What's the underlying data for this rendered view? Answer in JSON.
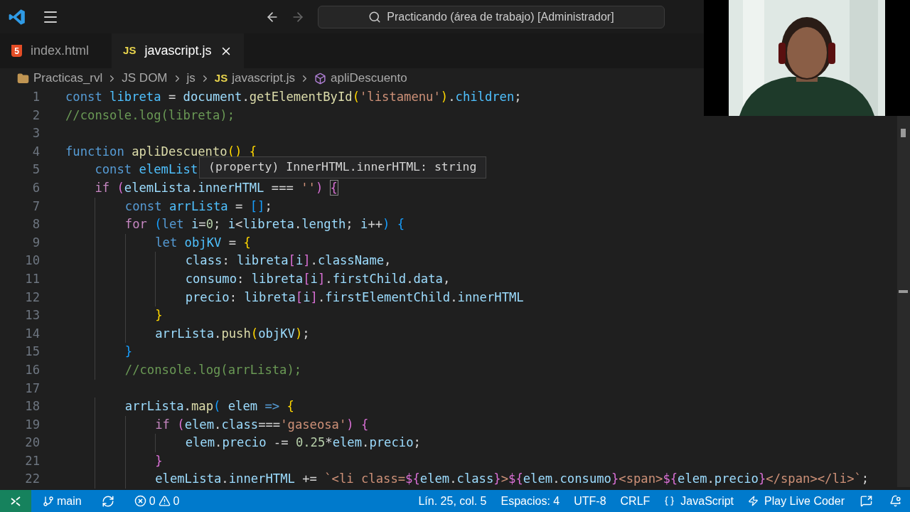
{
  "title_bar": {
    "search": "Practicando (área de trabajo) [Administrador]"
  },
  "tabs": [
    {
      "badge": "5",
      "label": "index.html",
      "kind": "html",
      "selected": false
    },
    {
      "badge": "JS",
      "label": "javascript.js",
      "kind": "js",
      "selected": true
    }
  ],
  "breadcrumbs": [
    {
      "kind": "folder",
      "label": "Practicas_rvl"
    },
    {
      "kind": "plain",
      "label": "JS DOM"
    },
    {
      "kind": "plain",
      "label": "js"
    },
    {
      "kind": "js",
      "badge": "JS",
      "label": "javascript.js"
    },
    {
      "kind": "symbol",
      "label": "apliDescuento"
    }
  ],
  "editor": {
    "lines": [
      {
        "number": "1",
        "tokens": [
          {
            "kind": "kw",
            "text": "const"
          },
          {
            "kind": "cvar",
            "text": " libreta"
          },
          {
            "kind": "pl",
            "text": " = "
          },
          {
            "kind": "var",
            "text": "document"
          },
          {
            "kind": "pl",
            "text": "."
          },
          {
            "kind": "fn",
            "text": "getElementById"
          },
          {
            "kind": "b1",
            "text": "("
          },
          {
            "kind": "str",
            "text": "'listamenu'"
          },
          {
            "kind": "b1",
            "text": ")"
          },
          {
            "kind": "pl",
            "text": "."
          },
          {
            "kind": "cvar",
            "text": "children"
          },
          {
            "kind": "pl",
            "text": ";"
          }
        ]
      },
      {
        "number": "2",
        "tokens": [
          {
            "kind": "comment",
            "text": "//console.log(libreta);"
          }
        ]
      },
      {
        "number": "3"
      },
      {
        "number": "4",
        "tokens": [
          {
            "kind": "kw",
            "text": "function"
          },
          {
            "kind": "fn",
            "text": " apliDescuento"
          },
          {
            "kind": "b1",
            "text": "()"
          },
          {
            "kind": "b1",
            "text": " {"
          }
        ]
      },
      {
        "number": "5",
        "tokens": [
          {
            "kind": "kw",
            "text": "    const"
          },
          {
            "kind": "cvar",
            "text": " elemList"
          }
        ]
      },
      {
        "number": "6",
        "tokens": [
          {
            "kind": "ctl",
            "text": "    if"
          },
          {
            "kind": "b2",
            "text": " ("
          },
          {
            "kind": "var",
            "text": "elemLista"
          },
          {
            "kind": "pl",
            "text": "."
          },
          {
            "kind": "var",
            "text": "innerHTML"
          },
          {
            "kind": "pl",
            "text": " === "
          },
          {
            "kind": "str",
            "text": "''"
          },
          {
            "kind": "b2",
            "text": ") "
          },
          {
            "kind": "match",
            "text": "{"
          }
        ]
      },
      {
        "number": "7",
        "tokens": [
          {
            "kind": "kw",
            "text": "        const"
          },
          {
            "kind": "cvar",
            "text": " arrLista"
          },
          {
            "kind": "pl",
            "text": " = "
          },
          {
            "kind": "b3",
            "text": "[]"
          },
          {
            "kind": "pl",
            "text": ";"
          }
        ]
      },
      {
        "number": "8",
        "tokens": [
          {
            "kind": "ctl",
            "text": "        for"
          },
          {
            "kind": "b3",
            "text": " ("
          },
          {
            "kind": "kw",
            "text": "let"
          },
          {
            "kind": "var",
            "text": " i"
          },
          {
            "kind": "pl",
            "text": "="
          },
          {
            "kind": "num",
            "text": "0"
          },
          {
            "kind": "pl",
            "text": "; "
          },
          {
            "kind": "var",
            "text": "i"
          },
          {
            "kind": "pl",
            "text": "<"
          },
          {
            "kind": "var",
            "text": "libreta"
          },
          {
            "kind": "pl",
            "text": "."
          },
          {
            "kind": "var",
            "text": "length"
          },
          {
            "kind": "pl",
            "text": "; "
          },
          {
            "kind": "var",
            "text": "i"
          },
          {
            "kind": "pl",
            "text": "++"
          },
          {
            "kind": "b3",
            "text": ")"
          },
          {
            "kind": "b3",
            "text": " {"
          }
        ]
      },
      {
        "number": "9",
        "tokens": [
          {
            "kind": "kw",
            "text": "            let"
          },
          {
            "kind": "cvar",
            "text": " objKV"
          },
          {
            "kind": "pl",
            "text": " = "
          },
          {
            "kind": "b1",
            "text": "{"
          }
        ]
      },
      {
        "number": "10",
        "tokens": [
          {
            "kind": "var",
            "text": "                class"
          },
          {
            "kind": "pl",
            "text": ": "
          },
          {
            "kind": "var",
            "text": "libreta"
          },
          {
            "kind": "b2",
            "text": "["
          },
          {
            "kind": "var",
            "text": "i"
          },
          {
            "kind": "b2",
            "text": "]"
          },
          {
            "kind": "pl",
            "text": "."
          },
          {
            "kind": "var",
            "text": "className"
          },
          {
            "kind": "pl",
            "text": ","
          }
        ]
      },
      {
        "number": "11",
        "tokens": [
          {
            "kind": "var",
            "text": "                consumo"
          },
          {
            "kind": "pl",
            "text": ": "
          },
          {
            "kind": "var",
            "text": "libreta"
          },
          {
            "kind": "b2",
            "text": "["
          },
          {
            "kind": "var",
            "text": "i"
          },
          {
            "kind": "b2",
            "text": "]"
          },
          {
            "kind": "pl",
            "text": "."
          },
          {
            "kind": "var",
            "text": "firstChild"
          },
          {
            "kind": "pl",
            "text": "."
          },
          {
            "kind": "var",
            "text": "data"
          },
          {
            "kind": "pl",
            "text": ","
          }
        ]
      },
      {
        "number": "12",
        "tokens": [
          {
            "kind": "var",
            "text": "                precio"
          },
          {
            "kind": "pl",
            "text": ": "
          },
          {
            "kind": "var",
            "text": "libreta"
          },
          {
            "kind": "b2",
            "text": "["
          },
          {
            "kind": "var",
            "text": "i"
          },
          {
            "kind": "b2",
            "text": "]"
          },
          {
            "kind": "pl",
            "text": "."
          },
          {
            "kind": "var",
            "text": "firstElementChild"
          },
          {
            "kind": "pl",
            "text": "."
          },
          {
            "kind": "var",
            "text": "innerHTML"
          }
        ]
      },
      {
        "number": "13",
        "tokens": [
          {
            "kind": "b1",
            "text": "            }"
          }
        ]
      },
      {
        "number": "14",
        "tokens": [
          {
            "kind": "var",
            "text": "            arrLista"
          },
          {
            "kind": "pl",
            "text": "."
          },
          {
            "kind": "fn",
            "text": "push"
          },
          {
            "kind": "b1",
            "text": "("
          },
          {
            "kind": "var",
            "text": "objKV"
          },
          {
            "kind": "b1",
            "text": ")"
          },
          {
            "kind": "pl",
            "text": ";"
          }
        ]
      },
      {
        "number": "15",
        "tokens": [
          {
            "kind": "b3",
            "text": "        }"
          }
        ]
      },
      {
        "number": "16",
        "tokens": [
          {
            "kind": "comment",
            "text": "        //console.log(arrLista);"
          }
        ]
      },
      {
        "number": "17"
      },
      {
        "number": "18",
        "tokens": [
          {
            "kind": "var",
            "text": "        arrLista"
          },
          {
            "kind": "pl",
            "text": "."
          },
          {
            "kind": "fn",
            "text": "map"
          },
          {
            "kind": "b3",
            "text": "("
          },
          {
            "kind": "var",
            "text": " elem"
          },
          {
            "kind": "kw",
            "text": " =>"
          },
          {
            "kind": "b1",
            "text": " {"
          }
        ]
      },
      {
        "number": "19",
        "tokens": [
          {
            "kind": "ctl",
            "text": "            if"
          },
          {
            "kind": "b2",
            "text": " ("
          },
          {
            "kind": "var",
            "text": "elem"
          },
          {
            "kind": "pl",
            "text": "."
          },
          {
            "kind": "var",
            "text": "class"
          },
          {
            "kind": "pl",
            "text": "==="
          },
          {
            "kind": "str",
            "text": "'gaseosa'"
          },
          {
            "kind": "b2",
            "text": ")"
          },
          {
            "kind": "b2",
            "text": " {"
          }
        ]
      },
      {
        "number": "20",
        "tokens": [
          {
            "kind": "var",
            "text": "                elem"
          },
          {
            "kind": "pl",
            "text": "."
          },
          {
            "kind": "var",
            "text": "precio"
          },
          {
            "kind": "pl",
            "text": " -= "
          },
          {
            "kind": "num",
            "text": "0.25"
          },
          {
            "kind": "pl",
            "text": "*"
          },
          {
            "kind": "var",
            "text": "elem"
          },
          {
            "kind": "pl",
            "text": "."
          },
          {
            "kind": "var",
            "text": "precio"
          },
          {
            "kind": "pl",
            "text": ";"
          }
        ]
      },
      {
        "number": "21",
        "tokens": [
          {
            "kind": "b2",
            "text": "            }"
          }
        ]
      },
      {
        "number": "22",
        "tokens": [
          {
            "kind": "var",
            "text": "            elemLista"
          },
          {
            "kind": "pl",
            "text": "."
          },
          {
            "kind": "var",
            "text": "innerHTML"
          },
          {
            "kind": "pl",
            "text": " += "
          },
          {
            "kind": "str",
            "text": "`<li class="
          },
          {
            "kind": "tmpl",
            "text": "${"
          },
          {
            "kind": "var",
            "text": "elem"
          },
          {
            "kind": "pl",
            "text": "."
          },
          {
            "kind": "var",
            "text": "class"
          },
          {
            "kind": "tmpl",
            "text": "}"
          },
          {
            "kind": "str",
            "text": ">"
          },
          {
            "kind": "tmpl",
            "text": "${"
          },
          {
            "kind": "var",
            "text": "elem"
          },
          {
            "kind": "pl",
            "text": "."
          },
          {
            "kind": "var",
            "text": "consumo"
          },
          {
            "kind": "tmpl",
            "text": "}"
          },
          {
            "kind": "str",
            "text": "<span>"
          },
          {
            "kind": "tmpl",
            "text": "${"
          },
          {
            "kind": "var",
            "text": "elem"
          },
          {
            "kind": "pl",
            "text": "."
          },
          {
            "kind": "var",
            "text": "precio"
          },
          {
            "kind": "tmpl",
            "text": "}"
          },
          {
            "kind": "str",
            "text": "</span></li>`"
          },
          {
            "kind": "pl",
            "text": ";"
          }
        ]
      }
    ],
    "tooltip": "(property) InnerHTML.innerHTML: string"
  },
  "status_bar": {
    "left": [
      {
        "kind": "branch",
        "label": "main"
      },
      {
        "kind": "sync"
      },
      {
        "kind": "problems",
        "errors": "0",
        "warnings": "0"
      }
    ],
    "right": [
      {
        "kind": "text",
        "label": "Lín. 25, col. 5"
      },
      {
        "kind": "text",
        "label": "Espacios: 4"
      },
      {
        "kind": "text",
        "label": "UTF-8"
      },
      {
        "kind": "text",
        "label": "CRLF"
      },
      {
        "kind": "language",
        "label": "JavaScript"
      },
      {
        "kind": "live",
        "label": "Play Live Coder"
      },
      {
        "kind": "feedback"
      },
      {
        "kind": "bell"
      }
    ]
  }
}
